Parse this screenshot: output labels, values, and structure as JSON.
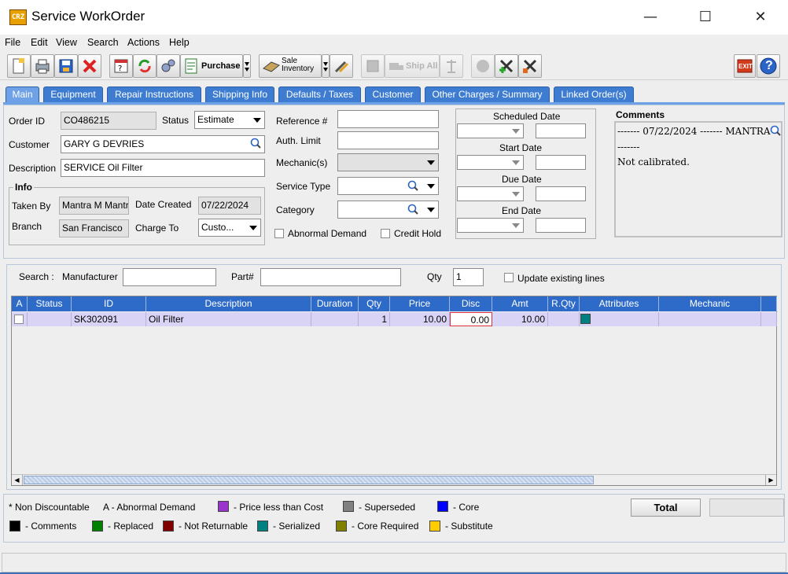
{
  "window": {
    "title": "Service WorkOrder",
    "icon_text": "CRZ",
    "minimize": "—",
    "maximize": "☐",
    "close": "✕"
  },
  "menu": [
    "File",
    "Edit",
    "View",
    "Search",
    "Actions",
    "Help"
  ],
  "toolbar": {
    "purchase_label": "Purchase",
    "sale_inventory_line1": "Sale",
    "sale_inventory_line2": "Inventory",
    "ship_all_label": "Ship All",
    "exit_label": "EXIT",
    "help_label": "?"
  },
  "tabs": [
    "Main",
    "Equipment",
    "Repair Instructions",
    "Shipping Info",
    "Defaults / Taxes",
    "Customer",
    "Other Charges / Summary",
    "Linked Order(s)"
  ],
  "form": {
    "order_id_label": "Order ID",
    "order_id": "CO486215",
    "status_label": "Status",
    "status": "Estimate",
    "customer_label": "Customer",
    "customer": "GARY G  DEVRIES",
    "description_label": "Description",
    "description": "SERVICE Oil Filter",
    "info_title": "Info",
    "taken_by_label": "Taken By",
    "taken_by": "Mantra M Mantra",
    "date_created_label": "Date Created",
    "date_created": "07/22/2024",
    "branch_label": "Branch",
    "branch": "San Francisco",
    "charge_to_label": "Charge To",
    "charge_to": "Custo...",
    "reference_label": "Reference #",
    "reference": "",
    "auth_limit_label": "Auth. Limit",
    "auth_limit": "",
    "mechanics_label": "Mechanic(s)",
    "service_type_label": "Service Type",
    "category_label": "Category",
    "abnormal_demand_label": "Abnormal Demand",
    "credit_hold_label": "Credit Hold"
  },
  "dates": {
    "scheduled": "Scheduled Date",
    "start": "Start Date",
    "due": "Due Date",
    "end": "End Date"
  },
  "comments": {
    "title": "Comments",
    "line1": "------- 07/22/2024 ------- MANTRA",
    "line2": "-------",
    "line3": "Not calibrated."
  },
  "search": {
    "label": "Search :",
    "manufacturer_label": "Manufacturer",
    "part_label": "Part#",
    "qty_label": "Qty",
    "qty": "1",
    "update_label": "Update existing lines"
  },
  "grid": {
    "columns": [
      "A",
      "Status",
      "ID",
      "Description",
      "Duration",
      "Qty",
      "Price",
      "Disc",
      "Amt",
      "R.Qty",
      "Attributes",
      "Mechanic"
    ],
    "rows": [
      {
        "a": "",
        "status": "",
        "id": "SK302091",
        "description": "Oil Filter",
        "duration": "",
        "qty": "1",
        "price": "10.00",
        "disc": "0.00",
        "amt": "10.00",
        "rqty": "",
        "attribute_color": "#008080",
        "mechanic": ""
      }
    ]
  },
  "legend": {
    "non_discountable": "* Non Discountable",
    "abnormal": "A - Abnormal Demand",
    "items": [
      {
        "color": "#9933cc",
        "label": "- Price less than Cost"
      },
      {
        "color": "#808080",
        "label": "- Superseded"
      },
      {
        "color": "#0000ff",
        "label": "- Core"
      },
      {
        "color": "#000000",
        "label": "- Comments"
      },
      {
        "color": "#008000",
        "label": "- Replaced"
      },
      {
        "color": "#800000",
        "label": "- Not Returnable"
      },
      {
        "color": "#008080",
        "label": "- Serialized"
      },
      {
        "color": "#808000",
        "label": "- Core Required"
      },
      {
        "color": "#ffcc00",
        "label": "- Substitute"
      }
    ],
    "total_label": "Total"
  }
}
